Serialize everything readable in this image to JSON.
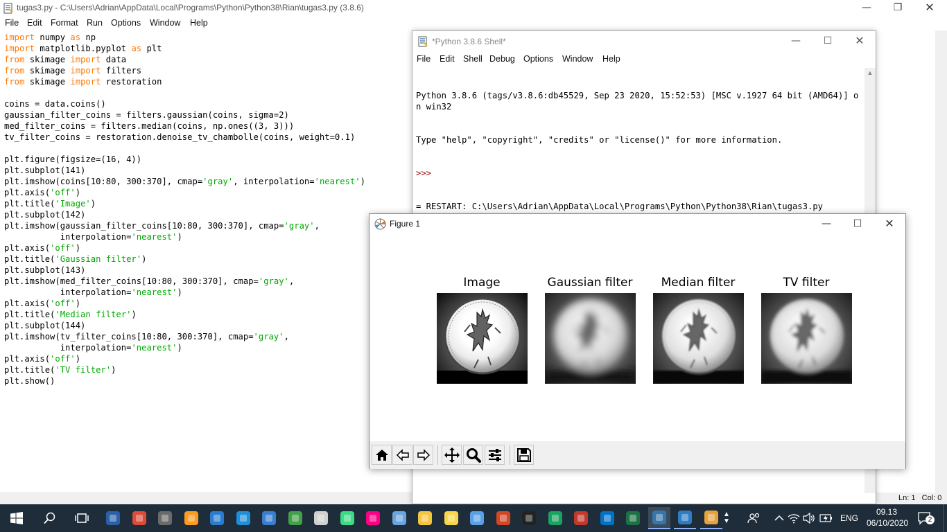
{
  "editor": {
    "title": "tugas3.py - C:\\Users\\Adrian\\AppData\\Local\\Programs\\Python\\Python38\\Rian\\tugas3.py (3.8.6)",
    "menu": [
      "File",
      "Edit",
      "Format",
      "Run",
      "Options",
      "Window",
      "Help"
    ],
    "code_lines": [
      [
        [
          "k",
          "import"
        ],
        [
          "t",
          " numpy "
        ],
        [
          "k",
          "as"
        ],
        [
          "t",
          " np"
        ]
      ],
      [
        [
          "k",
          "import"
        ],
        [
          "t",
          " matplotlib.pyplot "
        ],
        [
          "k",
          "as"
        ],
        [
          "t",
          " plt"
        ]
      ],
      [
        [
          "k",
          "from"
        ],
        [
          "t",
          " skimage "
        ],
        [
          "k",
          "import"
        ],
        [
          "t",
          " data"
        ]
      ],
      [
        [
          "k",
          "from"
        ],
        [
          "t",
          " skimage "
        ],
        [
          "k",
          "import"
        ],
        [
          "t",
          " filters"
        ]
      ],
      [
        [
          "k",
          "from"
        ],
        [
          "t",
          " skimage "
        ],
        [
          "k",
          "import"
        ],
        [
          "t",
          " restoration"
        ]
      ],
      [],
      [
        [
          "t",
          "coins = data.coins()"
        ]
      ],
      [
        [
          "t",
          "gaussian_filter_coins = filters.gaussian(coins, sigma=2)"
        ]
      ],
      [
        [
          "t",
          "med_filter_coins = filters.median(coins, np.ones((3, 3)))"
        ]
      ],
      [
        [
          "t",
          "tv_filter_coins = restoration.denoise_tv_chambolle(coins, weight=0.1)"
        ]
      ],
      [],
      [
        [
          "t",
          "plt.figure(figsize=(16, 4))"
        ]
      ],
      [
        [
          "t",
          "plt.subplot(141)"
        ]
      ],
      [
        [
          "t",
          "plt.imshow(coins[10:80, 300:370], cmap="
        ],
        [
          "s",
          "'gray'"
        ],
        [
          "t",
          ", interpolation="
        ],
        [
          "s",
          "'nearest'"
        ],
        [
          "t",
          ")"
        ]
      ],
      [
        [
          "t",
          "plt.axis("
        ],
        [
          "s",
          "'off'"
        ],
        [
          "t",
          ")"
        ]
      ],
      [
        [
          "t",
          "plt.title("
        ],
        [
          "s",
          "'Image'"
        ],
        [
          "t",
          ")"
        ]
      ],
      [
        [
          "t",
          "plt.subplot(142)"
        ]
      ],
      [
        [
          "t",
          "plt.imshow(gaussian_filter_coins[10:80, 300:370], cmap="
        ],
        [
          "s",
          "'gray'"
        ],
        [
          "t",
          ","
        ]
      ],
      [
        [
          "t",
          "           interpolation="
        ],
        [
          "s",
          "'nearest'"
        ],
        [
          "t",
          ")"
        ]
      ],
      [
        [
          "t",
          "plt.axis("
        ],
        [
          "s",
          "'off'"
        ],
        [
          "t",
          ")"
        ]
      ],
      [
        [
          "t",
          "plt.title("
        ],
        [
          "s",
          "'Gaussian filter'"
        ],
        [
          "t",
          ")"
        ]
      ],
      [
        [
          "t",
          "plt.subplot(143)"
        ]
      ],
      [
        [
          "t",
          "plt.imshow(med_filter_coins[10:80, 300:370], cmap="
        ],
        [
          "s",
          "'gray'"
        ],
        [
          "t",
          ","
        ]
      ],
      [
        [
          "t",
          "           interpolation="
        ],
        [
          "s",
          "'nearest'"
        ],
        [
          "t",
          ")"
        ]
      ],
      [
        [
          "t",
          "plt.axis("
        ],
        [
          "s",
          "'off'"
        ],
        [
          "t",
          ")"
        ]
      ],
      [
        [
          "t",
          "plt.title("
        ],
        [
          "s",
          "'Median filter'"
        ],
        [
          "t",
          ")"
        ]
      ],
      [
        [
          "t",
          "plt.subplot(144)"
        ]
      ],
      [
        [
          "t",
          "plt.imshow(tv_filter_coins[10:80, 300:370], cmap="
        ],
        [
          "s",
          "'gray'"
        ],
        [
          "t",
          ","
        ]
      ],
      [
        [
          "t",
          "           interpolation="
        ],
        [
          "s",
          "'nearest'"
        ],
        [
          "t",
          ")"
        ]
      ],
      [
        [
          "t",
          "plt.axis("
        ],
        [
          "s",
          "'off'"
        ],
        [
          "t",
          ")"
        ]
      ],
      [
        [
          "t",
          "plt.title("
        ],
        [
          "s",
          "'TV filter'"
        ],
        [
          "t",
          ")"
        ]
      ],
      [
        [
          "t",
          "plt.show()"
        ]
      ]
    ],
    "status": "Ln: 1   Col: 0"
  },
  "shell": {
    "title": "*Python 3.8.6 Shell*",
    "menu": [
      "File",
      "Edit",
      "Shell",
      "Debug",
      "Options",
      "Window",
      "Help"
    ],
    "banner_line1": "Python 3.8.6 (tags/v3.8.6:db45529, Sep 23 2020, 15:52:53) [MSC v.1927 64 bit (AMD64)] on win32",
    "banner_line2": "Type \"help\", \"copyright\", \"credits\" or \"license()\" for more information.",
    "prompt": ">>>",
    "restart": "= RESTART: C:\\Users\\Adrian\\AppData\\Local\\Programs\\Python\\Python38\\Rian\\tugas3.py"
  },
  "figure": {
    "title": "Figure 1",
    "panels": [
      {
        "title": "Image",
        "blur": 0,
        "contrast": 1.35
      },
      {
        "title": "Gaussian filter",
        "blur": 5,
        "contrast": 1.1
      },
      {
        "title": "Median filter",
        "blur": 1,
        "contrast": 1.2
      },
      {
        "title": "TV filter",
        "blur": 2.5,
        "contrast": 1.15
      }
    ],
    "toolbar": [
      "home-icon",
      "back-icon",
      "forward-icon",
      "pan-icon",
      "zoom-icon",
      "configure-subplots-icon",
      "save-icon"
    ]
  },
  "taskbar": {
    "apps": [
      "powershell",
      "chrome",
      "dev-cpp",
      "sublime-text",
      "vscode",
      "edge",
      "virtualbox",
      "snagit",
      "tools",
      "android-studio",
      "flickr",
      "browser",
      "file-explorer",
      "sticky-notes",
      "paint",
      "powerpoint",
      "cmd",
      "refresh-app",
      "network-app",
      "outlook",
      "excel",
      "python-idle",
      "photos",
      "media"
    ],
    "lang": "ENG",
    "time": "09.13",
    "date": "06/10/2020",
    "notifications": "2"
  },
  "colors": {
    "keyword": "#ff7700",
    "string": "#00aa00",
    "prompt": "#a00000",
    "taskbar": "#1f2d3a"
  }
}
